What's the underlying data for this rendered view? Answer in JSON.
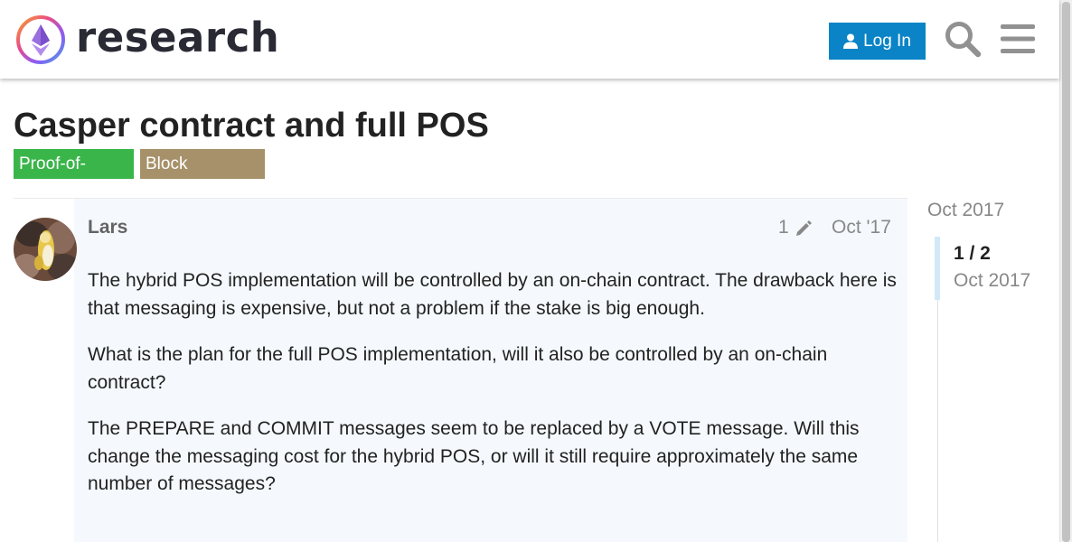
{
  "header": {
    "site_name": "research",
    "login_label": "Log In"
  },
  "topic": {
    "title": "Casper contract and full POS",
    "tags": [
      "Proof-of-Stake",
      "Block proposer"
    ]
  },
  "post": {
    "username": "Lars",
    "edit_count": "1",
    "date": "Oct '17",
    "paragraphs": [
      "The hybrid POS implementation will be controlled by an on-chain contract. The drawback here is that messaging is expensive, but not a problem if the stake is big enough.",
      "What is the plan for the full POS implementation, will it also be controlled by an on-chain contract?",
      "The PREPARE and COMMIT messages seem to be replaced by a VOTE message. Will this change the messaging cost for the hybrid POS, or will it still require approximately the same number of messages?"
    ]
  },
  "timeline": {
    "start_date": "Oct 2017",
    "position": "1 / 2",
    "current_date": "Oct 2017"
  },
  "icons": {
    "logo": "ethresear-logo-icon",
    "login": "user-icon",
    "search": "search-icon",
    "menu": "hamburger-menu-icon",
    "edit": "pencil-icon"
  },
  "colors": {
    "login_button": "#0a84c6",
    "tag_proof_of_stake": "#3ab54a",
    "tag_block_proposer": "#a7916a",
    "post_background": "#f5f9fd",
    "timeline_handle": "#d1e9f7"
  }
}
